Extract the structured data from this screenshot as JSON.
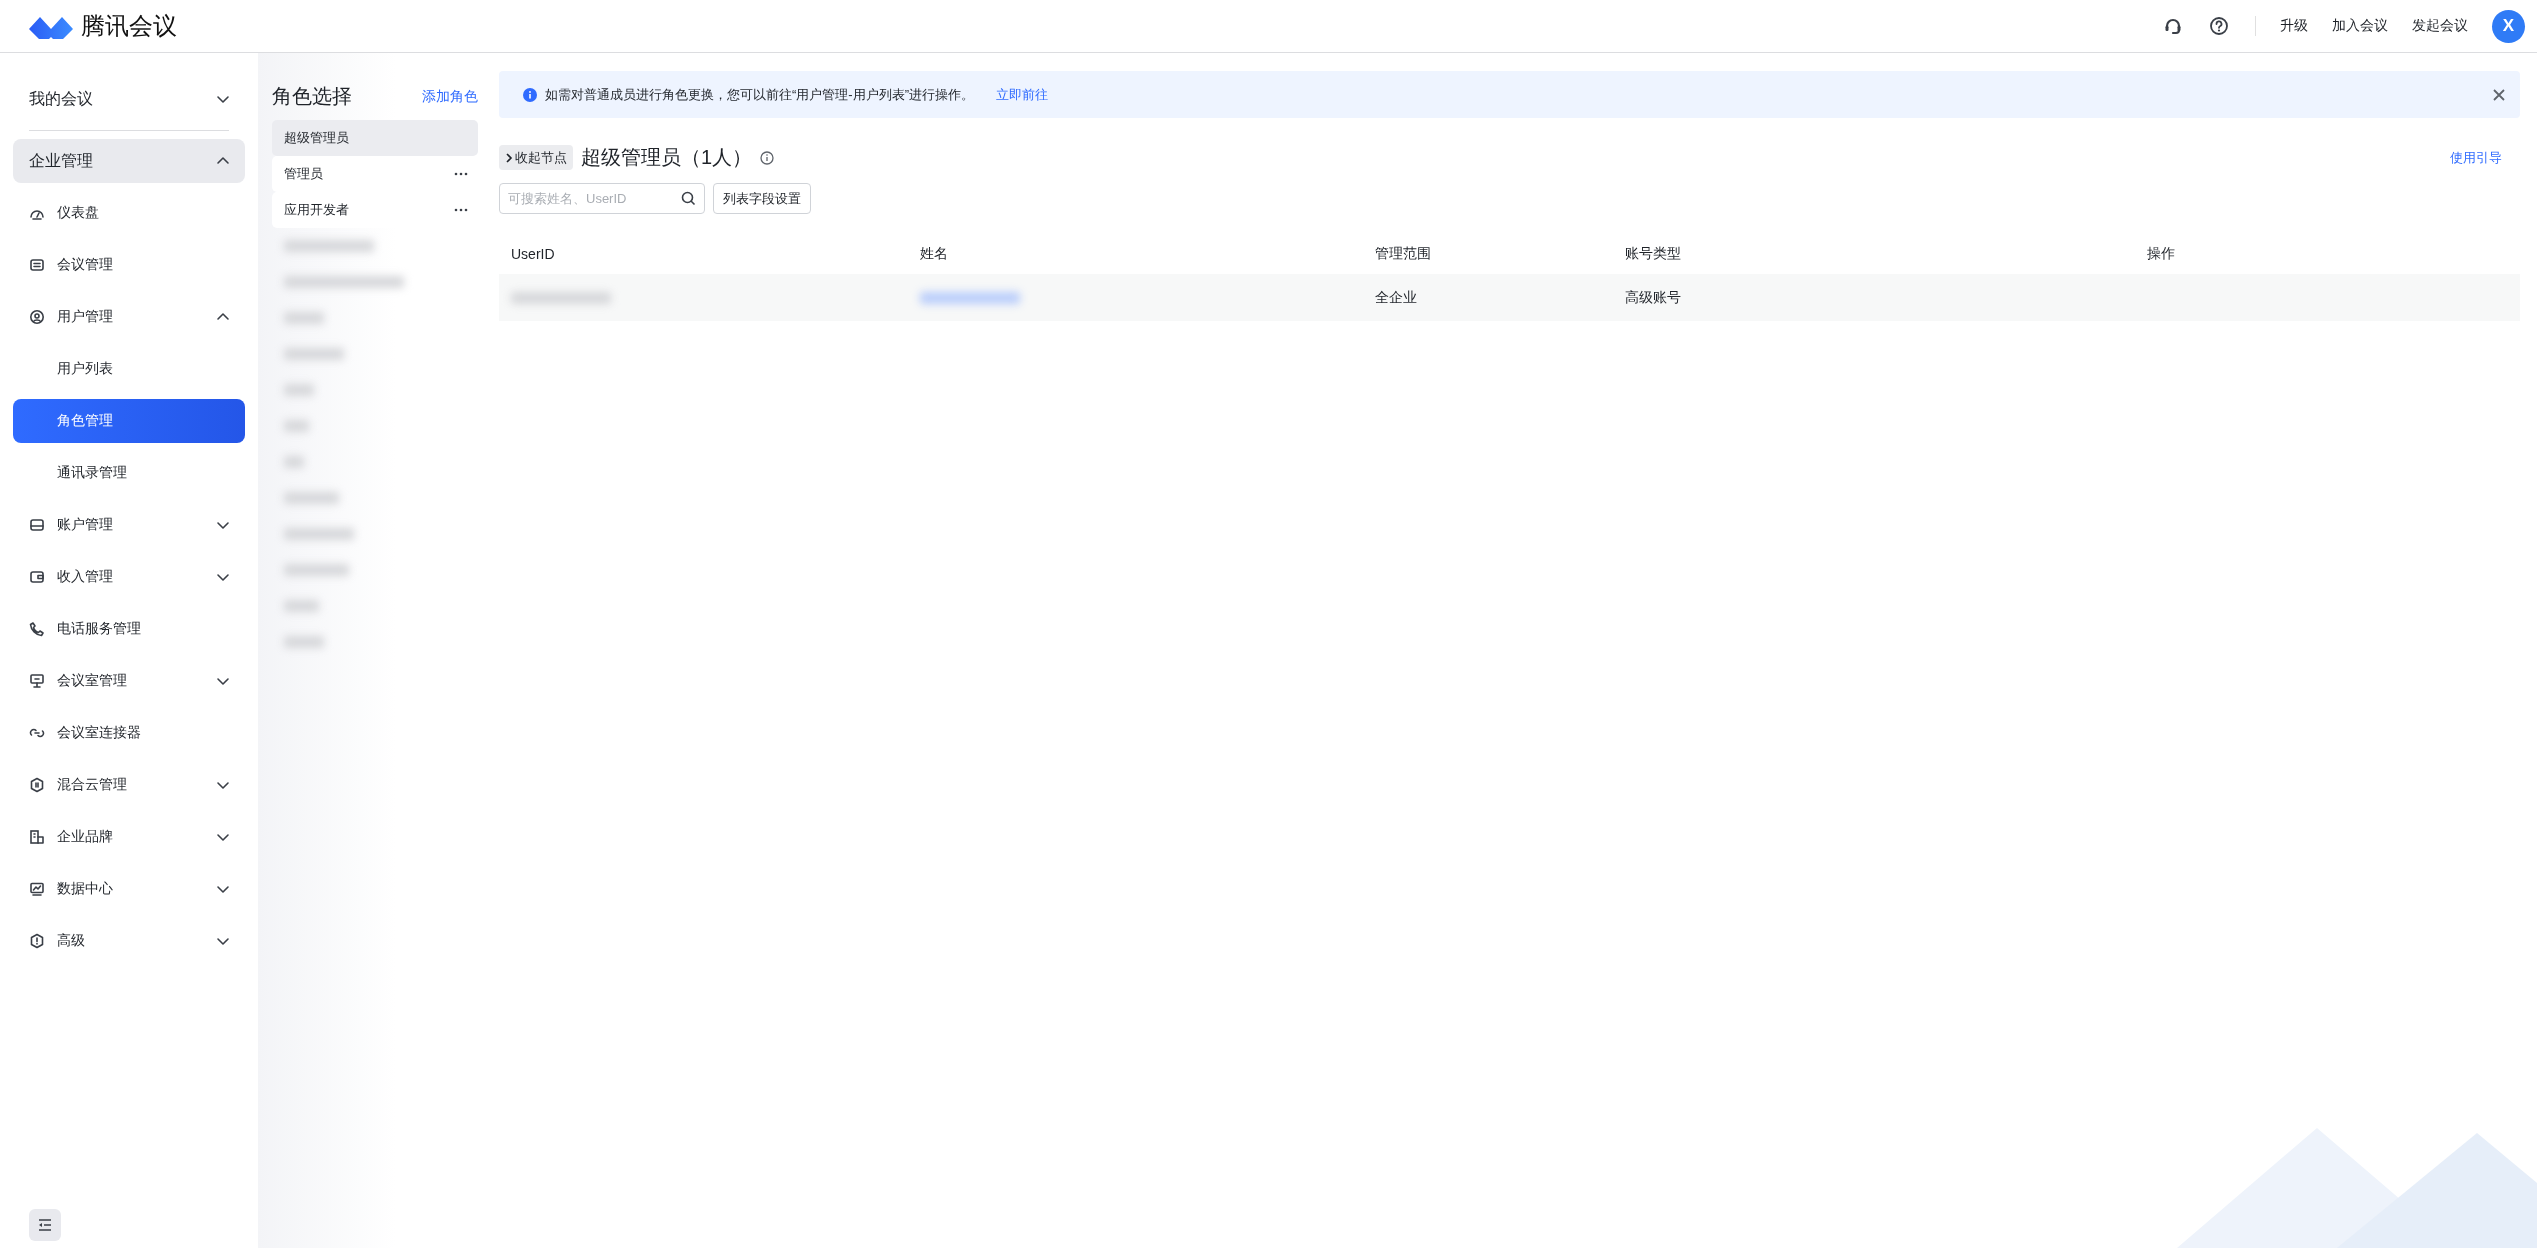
{
  "header": {
    "app_name": "腾讯会议",
    "actions": [
      "升级",
      "加入会议",
      "发起会议"
    ],
    "avatar": "X"
  },
  "sidebar": {
    "top": {
      "label": "我的会议",
      "expanded": false
    },
    "section": {
      "label": "企业管理",
      "expanded": true
    },
    "items": [
      {
        "label": "仪表盘",
        "kind": "page"
      },
      {
        "label": "会议管理",
        "kind": "page"
      },
      {
        "label": "用户管理",
        "kind": "group",
        "expanded": true,
        "children": [
          {
            "label": "用户列表",
            "selected": false
          },
          {
            "label": "角色管理",
            "selected": true
          },
          {
            "label": "通讯录管理",
            "selected": false
          }
        ]
      },
      {
        "label": "账户管理",
        "kind": "group",
        "expanded": false
      },
      {
        "label": "收入管理",
        "kind": "group",
        "expanded": false
      },
      {
        "label": "电话服务管理",
        "kind": "page"
      },
      {
        "label": "会议室管理",
        "kind": "group",
        "expanded": false
      },
      {
        "label": "会议室连接器",
        "kind": "page"
      },
      {
        "label": "混合云管理",
        "kind": "group",
        "expanded": false
      },
      {
        "label": "企业品牌",
        "kind": "group",
        "expanded": false
      },
      {
        "label": "数据中心",
        "kind": "group",
        "expanded": false
      },
      {
        "label": "高级",
        "kind": "group",
        "expanded": false
      }
    ]
  },
  "roles": {
    "title": "角色选择",
    "add_link": "添加角色",
    "items": [
      {
        "label": "超级管理员",
        "selected": true,
        "more": false
      },
      {
        "label": "管理员",
        "selected": false,
        "more": true
      },
      {
        "label": "应用开发者",
        "selected": false,
        "more": true
      }
    ]
  },
  "banner": {
    "text": "如需对普通成员进行角色更换，您可以前往“用户管理-用户列表”进行操作。",
    "link": "立即前往"
  },
  "content": {
    "collapse_button": "收起节点",
    "title": "超级管理员（1人）",
    "guide_link": "使用引导",
    "search": {
      "placeholder": "可搜索姓名、UserID"
    },
    "fields_button": "列表字段设置"
  },
  "table": {
    "columns": [
      "UserID",
      "姓名",
      "管理范围",
      "账号类型",
      "操作"
    ],
    "rows": [
      {
        "scope": "全企业",
        "account_type": "高级账号"
      }
    ]
  }
}
